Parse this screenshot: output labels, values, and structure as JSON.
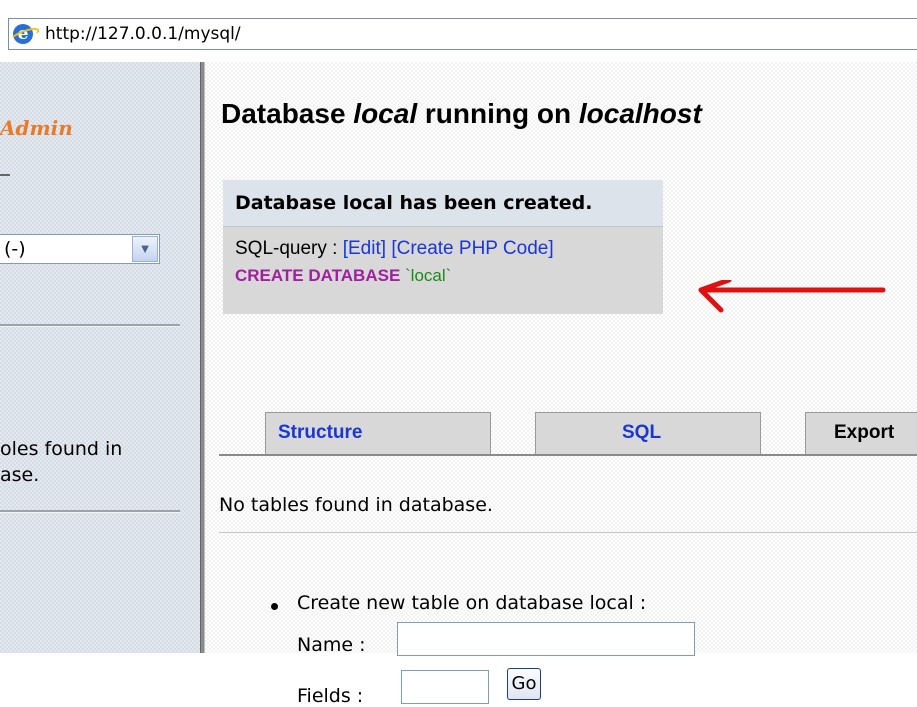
{
  "address_bar": {
    "url": "http://127.0.0.1/mysql/",
    "icon": "ie-icon"
  },
  "left_frame": {
    "logo_text": "Admin",
    "db_select": {
      "value": "(-)"
    },
    "message_line1": "oles found in",
    "message_line2": "ase."
  },
  "main": {
    "title": {
      "prefix": "Database ",
      "db_name": "local",
      "middle": " running on ",
      "host": "localhost"
    },
    "message": {
      "heading": "Database local has been created.",
      "sql_label": "SQL-query : ",
      "edit_link": "[Edit]",
      "php_link": "[Create PHP Code]",
      "sql_keyword": "CREATE DATABASE",
      "sql_name": " `local`"
    },
    "tabs": [
      {
        "label": "Structure"
      },
      {
        "label": "SQL"
      },
      {
        "label": "Export"
      }
    ],
    "no_tables": "No tables found in database.",
    "create_table": {
      "label": "Create new table on database local :",
      "name_label": "Name :",
      "name_value": "",
      "fields_label": "Fields :",
      "fields_value": "",
      "go_label": "Go"
    }
  },
  "colors": {
    "link": "#1a36d6",
    "sql_keyword": "#a020a0",
    "sql_string": "#1a8a1a",
    "arrow": "#e01010",
    "logo": "#e87a2a"
  }
}
